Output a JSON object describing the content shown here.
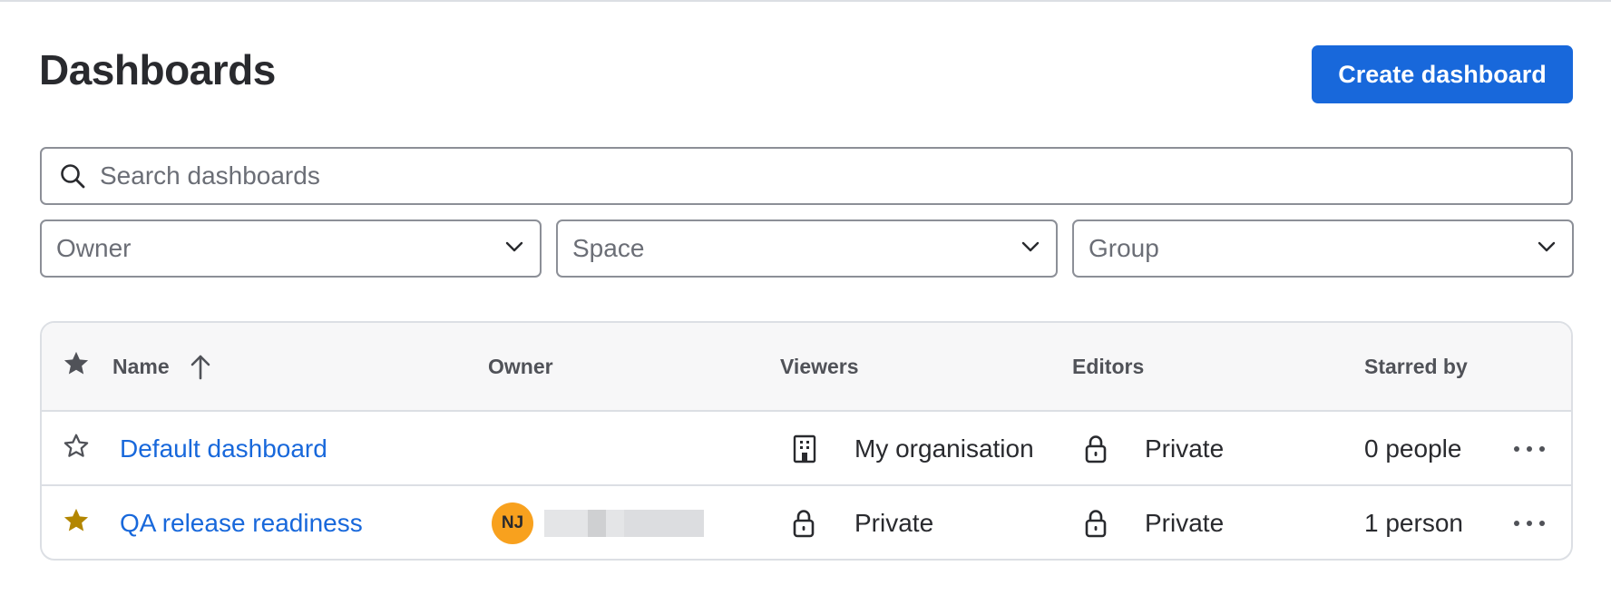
{
  "header": {
    "title": "Dashboards",
    "create_button": "Create dashboard"
  },
  "search": {
    "placeholder": "Search dashboards",
    "value": ""
  },
  "filters": {
    "owner": "Owner",
    "space": "Space",
    "group": "Group"
  },
  "table": {
    "columns": {
      "name": "Name",
      "owner": "Owner",
      "viewers": "Viewers",
      "editors": "Editors",
      "starred_by": "Starred by"
    },
    "sort": {
      "column": "Name",
      "direction": "ascending"
    },
    "rows": [
      {
        "starred": false,
        "name": "Default dashboard",
        "owner_initials": "",
        "viewers": "My organisation",
        "viewers_icon": "building-icon",
        "editors": "Private",
        "editors_icon": "lock-icon",
        "starred_by": "0 people"
      },
      {
        "starred": true,
        "name": "QA release readiness",
        "owner_initials": "NJ",
        "viewers": "Private",
        "viewers_icon": "lock-icon",
        "editors": "Private",
        "editors_icon": "lock-icon",
        "starred_by": "1 person"
      }
    ]
  },
  "colors": {
    "primary": "#1868db",
    "star_active": "#b38600",
    "avatar": "#f8a11e",
    "border": "#8c8f97"
  }
}
